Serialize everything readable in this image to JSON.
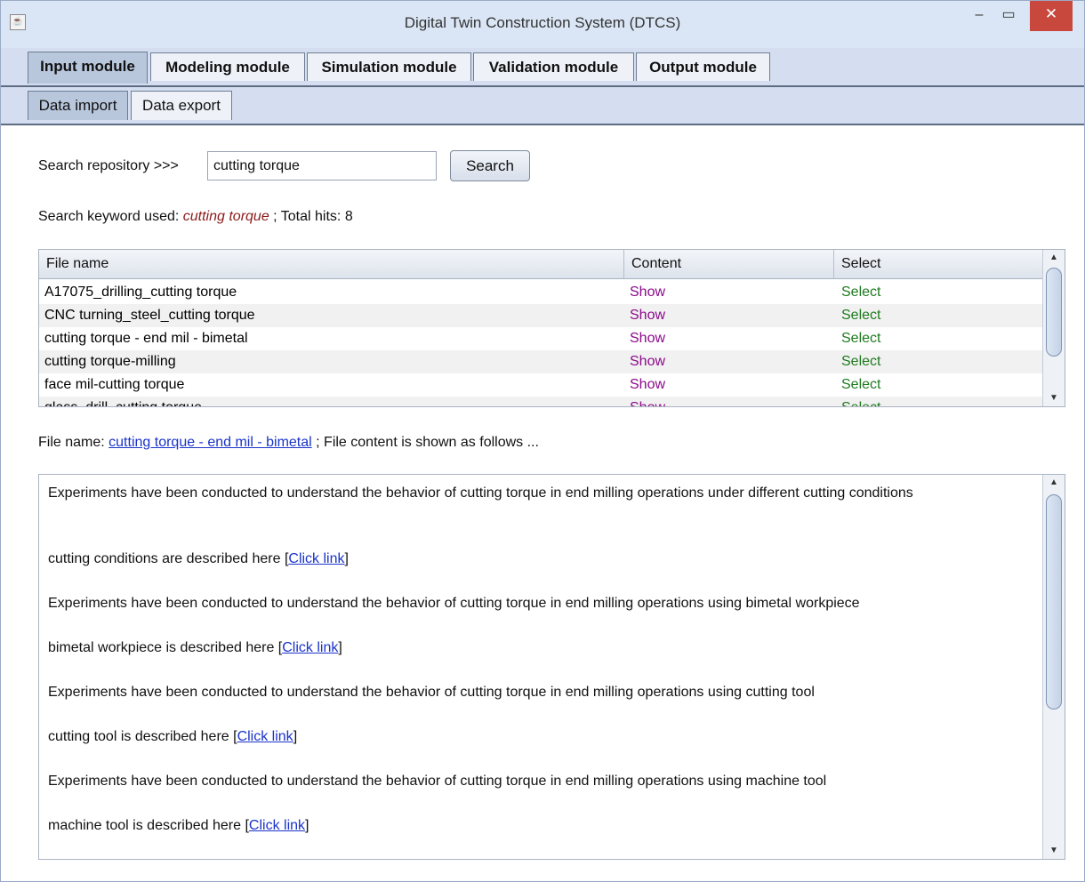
{
  "window": {
    "title": "Digital Twin Construction System (DTCS)",
    "minimize": "–",
    "maximize": "▭",
    "close": "✕",
    "app_icon": "java-cup-icon"
  },
  "main_tabs": [
    {
      "label": "Input module",
      "active": true
    },
    {
      "label": "Modeling module",
      "active": false
    },
    {
      "label": "Simulation module",
      "active": false
    },
    {
      "label": "Validation module",
      "active": false
    },
    {
      "label": "Output module",
      "active": false
    }
  ],
  "sub_tabs": [
    {
      "label": "Data import",
      "active": true
    },
    {
      "label": "Data export",
      "active": false
    }
  ],
  "search": {
    "label": "Search repository >>>",
    "value": "cutting torque",
    "button": "Search"
  },
  "summary": {
    "prefix": "Search keyword used:",
    "keyword": "cutting torque",
    "sep": ";",
    "hits_label": "Total hits:",
    "hits": "8"
  },
  "table": {
    "headers": [
      "File name",
      "Content",
      "Select"
    ],
    "rows": [
      {
        "name": "A17075_drilling_cutting torque",
        "content": "Show",
        "select": "Select"
      },
      {
        "name": "CNC turning_steel_cutting torque",
        "content": "Show",
        "select": "Select"
      },
      {
        "name": "cutting torque - end mil - bimetal",
        "content": "Show",
        "select": "Select"
      },
      {
        "name": "cutting torque-milling",
        "content": "Show",
        "select": "Select"
      },
      {
        "name": "face mil-cutting torque",
        "content": "Show",
        "select": "Select"
      },
      {
        "name": "glass_drill_cutting torque",
        "content": "Show",
        "select": "Select"
      }
    ]
  },
  "file_info": {
    "prefix": "File name:",
    "file": "cutting torque - end mil - bimetal",
    "suffix": "; File content is shown as follows ..."
  },
  "content": {
    "p1": "Experiments have been conducted to understand the behavior of cutting torque in end milling operations under different cutting conditions",
    "p2_text": "cutting conditions are described here [",
    "p3": "Experiments have been conducted to understand the behavior of cutting torque in end milling operations using bimetal workpiece",
    "p4_text": "bimetal workpiece is described here [",
    "p5": "Experiments have been conducted to understand the behavior of cutting torque in end milling operations using cutting tool",
    "p6_text": "cutting tool is described here [",
    "p7": "Experiments have been conducted to understand the behavior of cutting torque in end milling operations using machine tool",
    "p8_text": "machine tool is described here [",
    "link": "Click link",
    "close_bracket": "]"
  }
}
